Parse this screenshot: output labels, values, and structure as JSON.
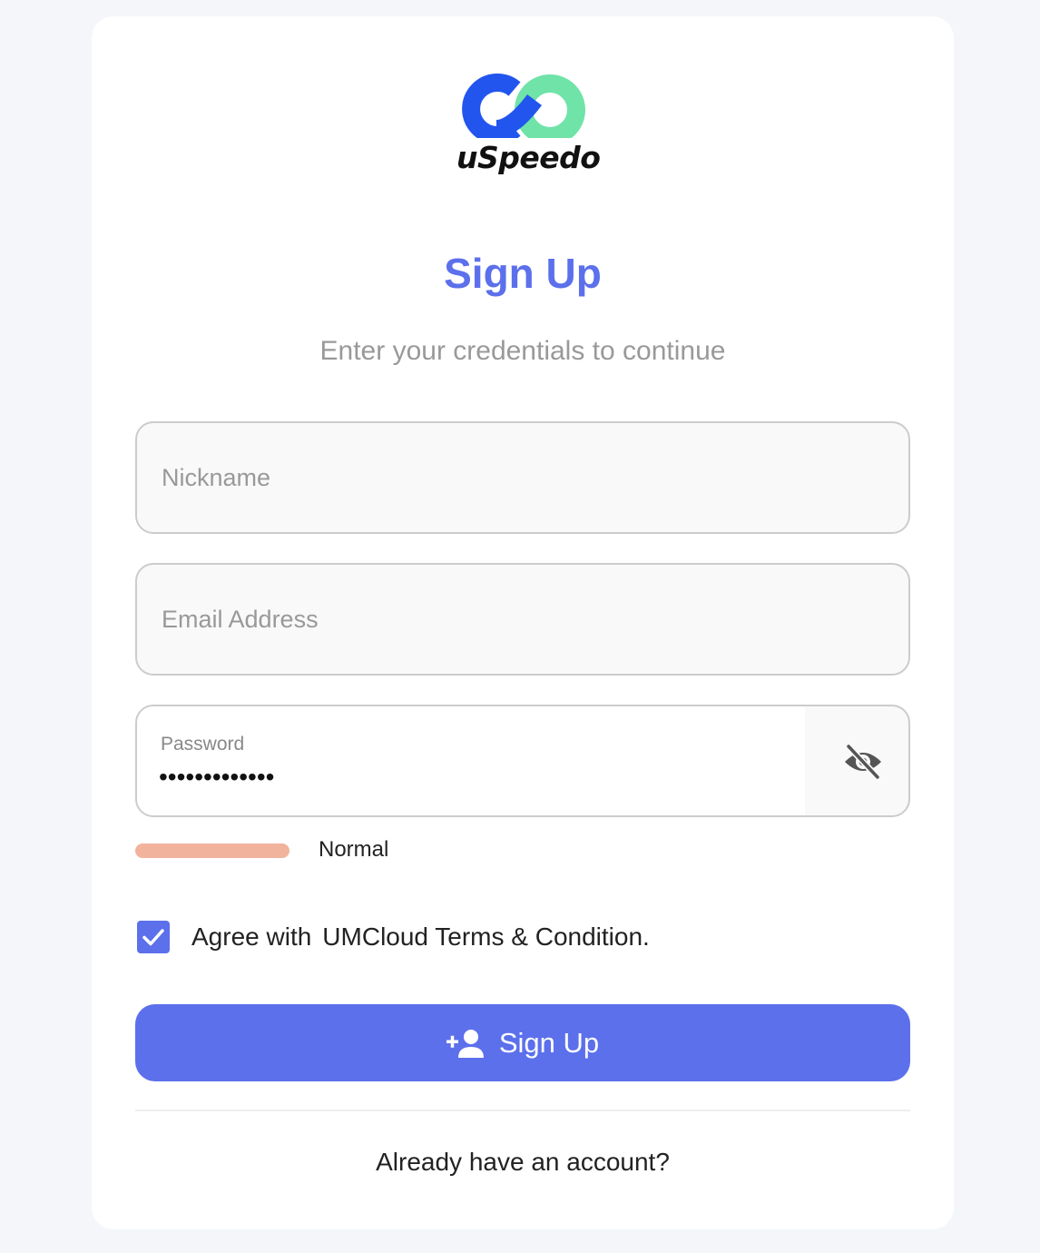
{
  "brand": {
    "name": "uSpeedo",
    "logo_icon": "infinity-link-icon",
    "colors": {
      "blue": "#2255ee",
      "green": "#6fe3a8"
    }
  },
  "form": {
    "title": "Sign Up",
    "subtitle": "Enter your credentials to continue",
    "nickname": {
      "placeholder": "Nickname",
      "value": ""
    },
    "email": {
      "placeholder": "Email Address",
      "value": ""
    },
    "password": {
      "label": "Password",
      "masked_value": "•••••••••••••",
      "toggle_icon": "eye-off-icon"
    },
    "strength": {
      "label": "Normal",
      "color": "#f2b39d"
    },
    "agree": {
      "checked": true,
      "prefix": "Agree with",
      "link_text": "UMCloud Terms & Condition."
    },
    "submit": {
      "label": "Sign Up",
      "icon": "add-user-icon",
      "color": "#5c70ec"
    },
    "login_prompt": "Already have an account?"
  }
}
